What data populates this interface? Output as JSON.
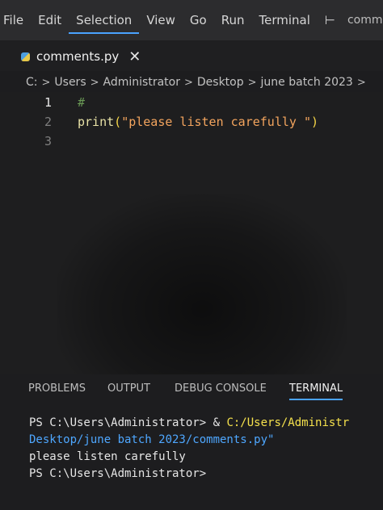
{
  "menubar": {
    "items": [
      "File",
      "Edit",
      "Selection",
      "View",
      "Go",
      "Run",
      "Terminal",
      "⊢"
    ],
    "title": "comm"
  },
  "tab": {
    "filename": "comments.py",
    "close_glyph": "✕"
  },
  "breadcrumb": {
    "items": [
      "C:",
      "Users",
      "Administrator",
      "Desktop",
      "june batch 2023"
    ],
    "separator": ">"
  },
  "editor": {
    "lines": [
      {
        "number": "1",
        "comment": "#"
      },
      {
        "number": "2",
        "func": "print",
        "open_paren": "(",
        "string": "\"please listen carefully \"",
        "close_paren": ")"
      },
      {
        "number": "3"
      }
    ]
  },
  "panel": {
    "tabs": [
      "PROBLEMS",
      "OUTPUT",
      "DEBUG CONSOLE",
      "TERMINAL"
    ],
    "active_tab": "TERMINAL"
  },
  "terminal": {
    "line1_prompt": "PS C:\\Users\\Administrator> & ",
    "line1_path": "C:/Users/Administr",
    "line2": "Desktop/june batch 2023/comments.py\"",
    "line3": "please listen carefully",
    "line4": "PS C:\\Users\\Administrator>"
  },
  "colors": {
    "accent": "#4aa3ff",
    "string": "#f4a55e",
    "comment": "#6a9955",
    "terminal_path": "#f5e14c"
  }
}
